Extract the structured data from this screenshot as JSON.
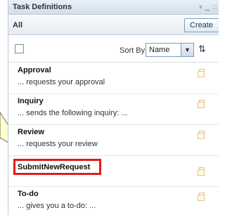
{
  "panel": {
    "title": "Task Definitions",
    "window_icons": [
      "menu-arrow-icon",
      "minimize-icon",
      "maximize-icon"
    ]
  },
  "filter": {
    "label": "All",
    "create_label": "Create"
  },
  "toolbar": {
    "sort_label": "Sort By",
    "sort_value": "Name"
  },
  "items": [
    {
      "title": "Approval",
      "desc": "... requests your approval"
    },
    {
      "title": "Inquiry",
      "desc": "... sends the following inquiry: ..."
    },
    {
      "title": "Review",
      "desc": "... requests your review"
    },
    {
      "title": "SubmitNewRequest",
      "desc": "",
      "highlighted": true
    },
    {
      "title": "To-do",
      "desc": "... gives you a to-do: ..."
    }
  ],
  "colors": {
    "highlight": "#e21b1b",
    "callout_fill": "#ffffcc",
    "header_bg": "#d2deea"
  }
}
